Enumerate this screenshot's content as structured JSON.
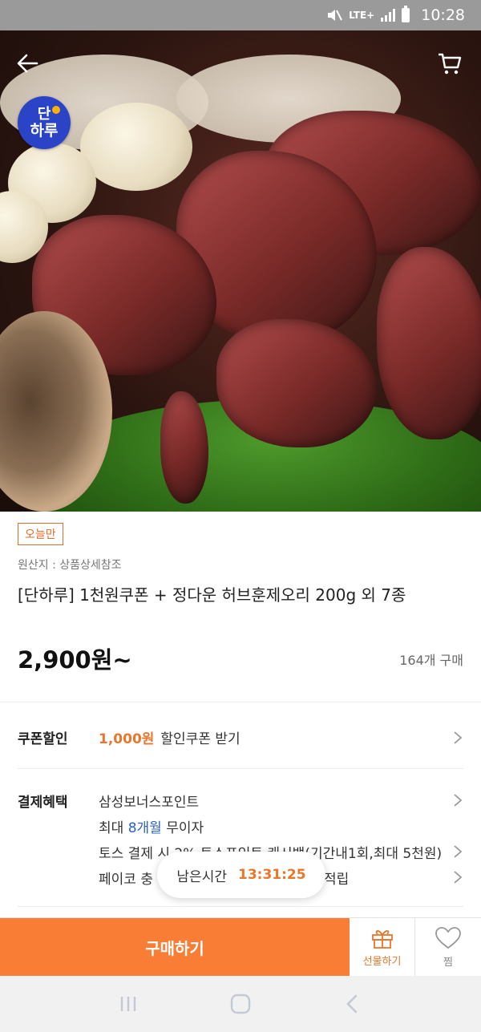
{
  "status_bar": {
    "network": "LTE+",
    "time": "10:28"
  },
  "brand": {
    "logo_line1": "단",
    "logo_line2": "하루"
  },
  "product": {
    "badge": "오늘만",
    "origin": "원산지 : 상품상세참조",
    "title": "[단하루] 1천원쿠폰 + 정다운 허브훈제오리 200g 외 7종",
    "price": "2,900원~",
    "sold_count": "164개 구매"
  },
  "coupon": {
    "label": "쿠폰할인",
    "amount": "1,000원",
    "text": "할인쿠폰 받기"
  },
  "payment": {
    "label": "결제혜택",
    "lines": [
      "삼성보너스포인트",
      "최대 ",
      "8개월",
      " 무이자",
      "토스 결제 시 2% 토스포인트 캐시백(기간내1회,최대 5천원)",
      "페이코 충",
      "적립"
    ]
  },
  "timer": {
    "label": "남은시간",
    "value": "13:31:25"
  },
  "actions": {
    "buy": "구매하기",
    "gift": "선물하기",
    "wish": "찜"
  },
  "icons": [
    "back-arrow-icon",
    "cart-icon",
    "chevron-right-icon",
    "gift-icon",
    "heart-icon",
    "recent-apps-icon",
    "home-icon",
    "nav-back-icon"
  ],
  "colors": {
    "accent": "#f97d35",
    "highlight_blue": "#2a64c9",
    "brand_blue": "#2a43c7"
  }
}
